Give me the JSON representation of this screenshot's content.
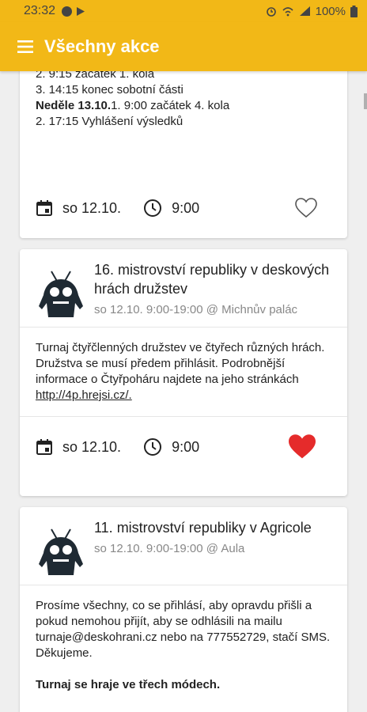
{
  "status": {
    "time": "23:32",
    "battery": "100%"
  },
  "app": {
    "title": "Všechny akce"
  },
  "card1": {
    "lines": [
      {
        "bold": "",
        "text": "2. 9:15 začátek 1. kola"
      },
      {
        "bold": "",
        "text": "3. 14:15 konec sobotní části"
      },
      {
        "bold": "Neděle 13.10.",
        "text": "1. 9:00 začátek 4. kola"
      },
      {
        "bold": "",
        "text": "2. 17:15 Vyhlášení výsledků"
      }
    ],
    "date": "so 12.10.",
    "time": "9:00",
    "favorite": false
  },
  "card2": {
    "title": "16. mistrovství republiky v deskových hrách družstev",
    "meta": "so 12.10. 9:00-19:00 @ Michnův palác",
    "body": "Turnaj čtyřčlenných družstev ve čtyřech různých hrách. Družstva se musí předem přihlásit. Podrobnější informace o Čtyřpoháru najdete na jeho stránkách ",
    "link": "http://4p.hrejsi.cz/.",
    "date": "so 12.10.",
    "time": "9:00",
    "favorite": true
  },
  "card3": {
    "title": "11. mistrovství republiky v Agricole",
    "meta": "so 12.10. 9:00-19:00 @ Aula",
    "body": "Prosíme všechny, co se přihlásí, aby opravdu přišli a pokud nemohou přijít, aby se odhlásili na mailu turnaje@deskohrani.cz nebo na 777552729, stačí SMS. Děkujeme.",
    "body_bold": "Turnaj se hraje ve třech módech."
  },
  "colors": {
    "accent": "#f2b817",
    "heart_active": "#e52b2b"
  }
}
